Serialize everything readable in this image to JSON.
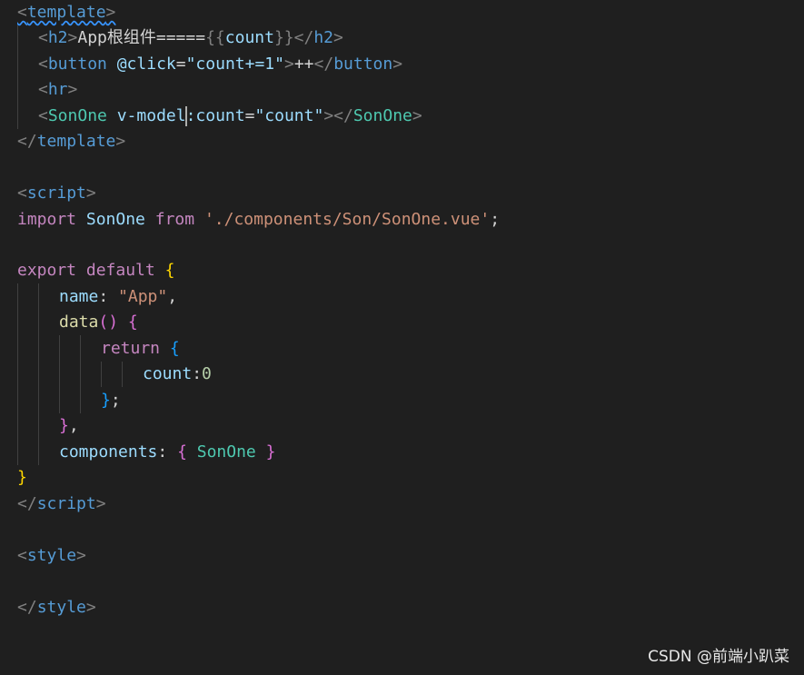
{
  "code": {
    "l1_open": "<",
    "l1_tag": "template",
    "l1_close": ">",
    "l2": {
      "open": "<",
      "tag": "h2",
      "close": ">",
      "text": "App根组件=====",
      "mustache_open": "{{",
      "var": "count",
      "mustache_close": "}}",
      "end_open": "</",
      "end_tag": "h2",
      "end_close": ">"
    },
    "l3": {
      "open": "<",
      "tag": "button",
      "attr": "@click",
      "eq": "=",
      "val": "\"count+=1\"",
      "close": ">",
      "text": "++",
      "end_open": "</",
      "end_tag": "button",
      "end_close": ">"
    },
    "l4": {
      "open": "<",
      "tag": "hr",
      "close": ">"
    },
    "l5": {
      "open": "<",
      "tag": "SonOne",
      "attr1_a": "v-model",
      "attr1_b": ":count",
      "eq": "=",
      "val": "\"count\"",
      "close": ">",
      "end_open": "</",
      "end_tag": "SonOne",
      "end_close": ">"
    },
    "l6": {
      "open": "</",
      "tag": "template",
      "close": ">"
    },
    "l8": {
      "open": "<",
      "tag": "script",
      "close": ">"
    },
    "l9": {
      "kw1": "import",
      "name": "SonOne",
      "kw2": "from",
      "path": "'./components/Son/SonOne.vue'",
      "semi": ";"
    },
    "l11": {
      "kw1": "export",
      "kw2": "default",
      "brace": "{"
    },
    "l12": {
      "key": "name",
      "colon": ": ",
      "val": "\"App\"",
      "comma": ","
    },
    "l13": {
      "fn": "data",
      "paren": "()",
      "brace": "{"
    },
    "l14": {
      "kw": "return",
      "brace": "{"
    },
    "l15": {
      "key": "count",
      "colon": ":",
      "num": "0"
    },
    "l16": {
      "brace": "}",
      "semi": ";"
    },
    "l17": {
      "brace": "}",
      "comma": ","
    },
    "l18": {
      "key": "components",
      "colon": ": ",
      "brace_open": "{",
      "name": "SonOne",
      "brace_close": "}"
    },
    "l19": {
      "brace": "}"
    },
    "l20": {
      "open": "</",
      "tag": "script",
      "close": ">"
    },
    "l22": {
      "open": "<",
      "tag": "style",
      "close": ">"
    },
    "l24": {
      "open": "</",
      "tag": "style",
      "close": ">"
    }
  },
  "watermark": "CSDN @前端小趴菜",
  "colors": {
    "background": "#1f1f1f",
    "tag": "#569cd6",
    "attribute": "#9cdcfe",
    "string": "#ce9178",
    "keyword": "#c586c0",
    "class": "#4ec9b0"
  }
}
